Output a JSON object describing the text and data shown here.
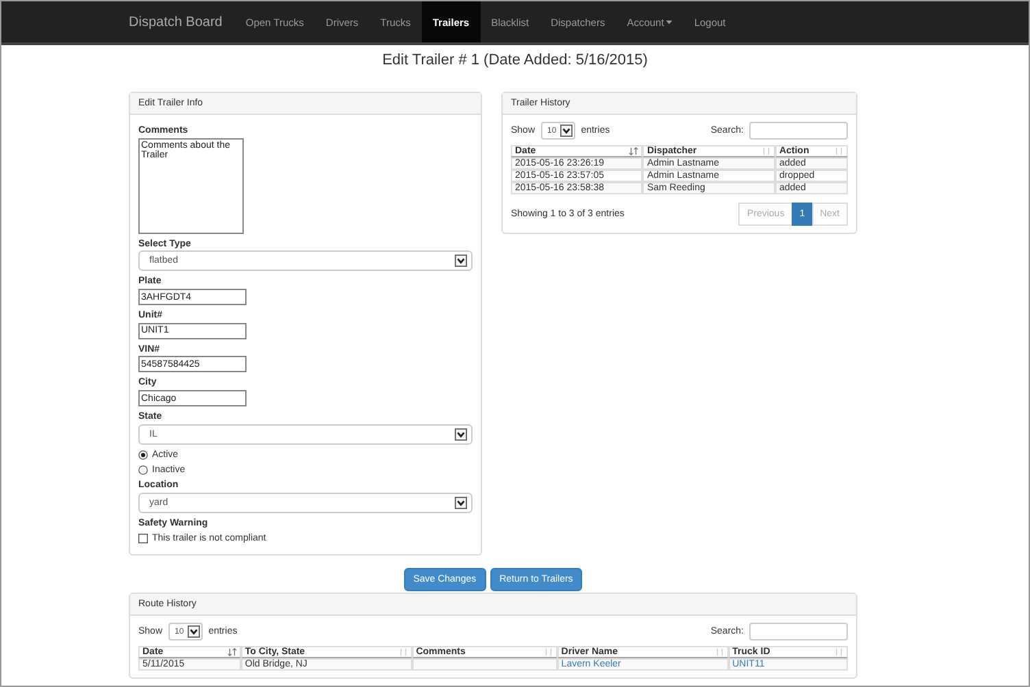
{
  "navbar": {
    "brand": "Dispatch Board",
    "items": [
      {
        "label": "Open Trucks",
        "selected": false,
        "kind": "link"
      },
      {
        "label": "Drivers",
        "selected": false,
        "kind": "link"
      },
      {
        "label": "Trucks",
        "selected": false,
        "kind": "link"
      },
      {
        "label": "Trailers",
        "selected": true,
        "kind": "link"
      },
      {
        "label": "Blacklist",
        "selected": false,
        "kind": "link"
      },
      {
        "label": "Dispatchers",
        "selected": false,
        "kind": "link"
      },
      {
        "label": "Account",
        "selected": false,
        "kind": "dropdown"
      },
      {
        "label": "Logout",
        "selected": false,
        "kind": "link"
      }
    ]
  },
  "title": "Edit Trailer # 1 (Date Added: 5/16/2015)",
  "edit_panel": {
    "title": "Edit Trailer Info",
    "fields": [
      {
        "kind": "textarea",
        "label": "Comments",
        "value": "Comments about the Trailer"
      },
      {
        "kind": "select",
        "label": "Select Type",
        "value": "flatbed"
      },
      {
        "kind": "input",
        "label": "Plate",
        "value": "3AHFGDT4"
      },
      {
        "kind": "input",
        "label": "Unit#",
        "value": "UNIT1"
      },
      {
        "kind": "input",
        "label": "VIN#",
        "value": "54587584425"
      },
      {
        "kind": "input",
        "label": "City",
        "value": "Chicago"
      },
      {
        "kind": "select",
        "label": "State",
        "value": "IL"
      },
      {
        "kind": "radios",
        "options": [
          {
            "label": "Active",
            "selected": true
          },
          {
            "label": "Inactive",
            "selected": false
          }
        ]
      },
      {
        "kind": "select",
        "label": "Location",
        "value": "yard"
      },
      {
        "kind": "checkbox",
        "label": "Safety Warning",
        "text": "This trailer is not compliant",
        "checked": false
      }
    ]
  },
  "history_panel": {
    "title": "Trailer History",
    "show_label": "Show",
    "page_size": "10",
    "entries_label": "entries",
    "search_label": "Search:",
    "columns": [
      {
        "label": "Date",
        "sorted": true
      },
      {
        "label": "Dispatcher",
        "sorted": false
      },
      {
        "label": "Action",
        "sorted": false
      }
    ],
    "rows": [
      [
        "2015-05-16 23:26:19",
        "Admin Lastname",
        "added"
      ],
      [
        "2015-05-16 23:57:05",
        "Admin Lastname",
        "dropped"
      ],
      [
        "2015-05-16 23:58:38",
        "Sam Reeding",
        "added"
      ]
    ],
    "info": "Showing 1 to 3 of 3 entries",
    "pagination": [
      {
        "label": "Previous",
        "selected": false,
        "disabled": true
      },
      {
        "label": "1",
        "selected": true,
        "disabled": false
      },
      {
        "label": "Next",
        "selected": false,
        "disabled": true
      }
    ]
  },
  "buttons": [
    {
      "label": "Save Changes"
    },
    {
      "label": "Return to Trailers"
    }
  ],
  "route_panel": {
    "title": "Route History",
    "show_label": "Show",
    "page_size": "10",
    "entries_label": "entries",
    "search_label": "Search:",
    "columns": [
      {
        "label": "Date",
        "sorted": true,
        "link": false
      },
      {
        "label": "To City, State",
        "sorted": false,
        "link": false
      },
      {
        "label": "Comments",
        "sorted": false
      },
      {
        "label": "Driver Name",
        "sorted": false,
        "link": true
      },
      {
        "label": "Truck ID",
        "sorted": false,
        "link": true
      }
    ],
    "rows": [
      [
        "5/11/2015",
        "Old Bridge, NJ",
        "",
        "Lavern Keeler",
        "UNIT11"
      ]
    ]
  }
}
